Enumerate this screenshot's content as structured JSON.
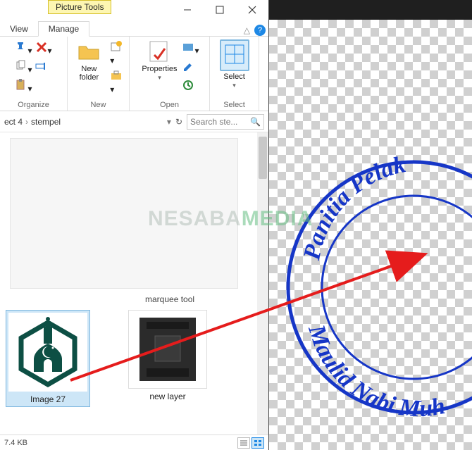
{
  "titlebar": {
    "contextual_tab": "Picture Tools"
  },
  "tabs": {
    "view": "View",
    "manage": "Manage"
  },
  "ribbon": {
    "organize": {
      "label": "Organize"
    },
    "new": {
      "label": "New",
      "new_folder": "New\nfolder"
    },
    "open": {
      "label": "Open",
      "properties": "Properties"
    },
    "select": {
      "label": "Select",
      "select_btn": "Select"
    }
  },
  "breadcrumb": {
    "part1": "ect 4",
    "part2": "stempel"
  },
  "search": {
    "placeholder": "Search ste..."
  },
  "files": {
    "marquee_label": "marquee tool",
    "image27": "Image 27",
    "newlayer": "new layer"
  },
  "status": {
    "size": "7.4 KB"
  },
  "stamp": {
    "top_text": "Panitia Pelak",
    "bottom_text": "Maulid Nabi Muh"
  },
  "watermark": {
    "part1": "NESABA",
    "part2": "MEDIA"
  }
}
